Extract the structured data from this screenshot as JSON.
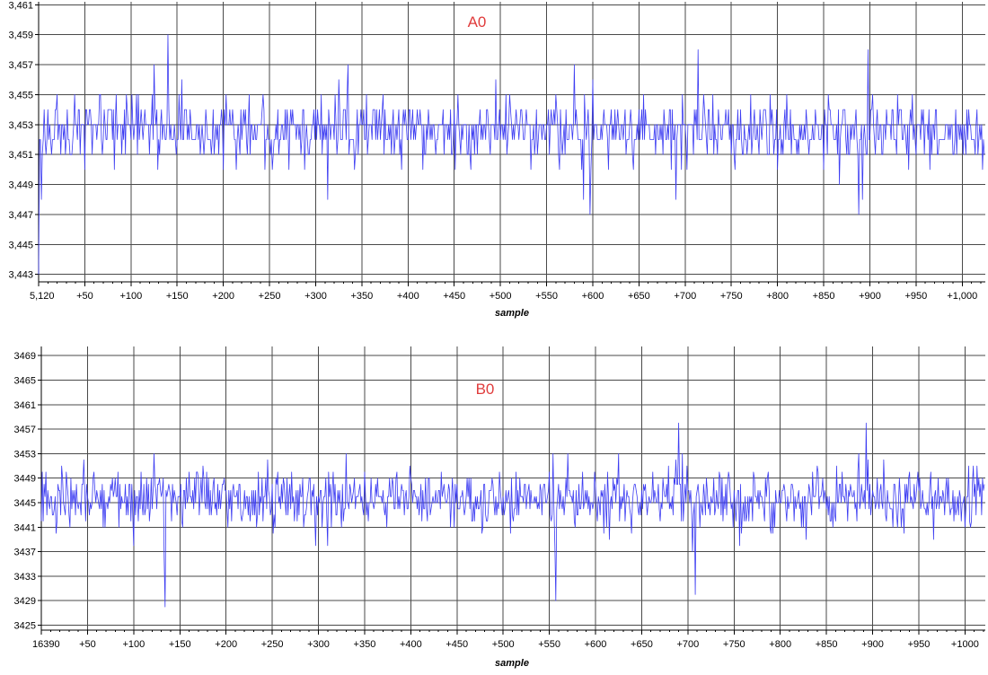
{
  "colors": {
    "series": "#3d3df2",
    "grid": "#4a4a4a",
    "axis": "#000000",
    "label": "#e03c3c",
    "text": "#000000"
  },
  "chart_data": [
    {
      "type": "line",
      "title": "A0",
      "xlabel": "sample",
      "ylabel": "",
      "grid": true,
      "legend": "none",
      "xlim": [
        0,
        1025
      ],
      "ylim": [
        3442.5,
        3461.2
      ],
      "x_ticks": [
        0,
        50,
        100,
        150,
        200,
        250,
        300,
        350,
        400,
        450,
        500,
        550,
        600,
        650,
        700,
        750,
        800,
        850,
        900,
        950,
        1000
      ],
      "x_tick_labels": [
        "5,120",
        "+50",
        "+100",
        "+150",
        "+200",
        "+250",
        "+300",
        "+350",
        "+400",
        "+450",
        "+500",
        "+550",
        "+600",
        "+650",
        "+700",
        "+750",
        "+800",
        "+850",
        "+900",
        "+950",
        "+1,000"
      ],
      "y_ticks": [
        3443,
        3445,
        3447,
        3449,
        3451,
        3453,
        3455,
        3457,
        3459,
        3461
      ],
      "y_tick_labels": [
        "3,443",
        "3,445",
        "3,447",
        "3,449",
        "3,451",
        "3,453",
        "3,455",
        "3,457",
        "3,459",
        "3,461"
      ],
      "series": [
        {
          "baseline": 3452.6,
          "noise": 1.0,
          "quantum": 1,
          "seed": 17,
          "spikes": [
            [
              0,
              3443
            ],
            [
              3,
              3448
            ],
            [
              20,
              3455
            ],
            [
              50,
              3450
            ],
            [
              125,
              3457
            ],
            [
              140,
              3459
            ],
            [
              155,
              3456
            ],
            [
              200,
              3450
            ],
            [
              214,
              3450
            ],
            [
              313,
              3448
            ],
            [
              325,
              3456
            ],
            [
              335,
              3457
            ],
            [
              355,
              3455
            ],
            [
              495,
              3456
            ],
            [
              510,
              3455
            ],
            [
              560,
              3455
            ],
            [
              580,
              3457
            ],
            [
              590,
              3448
            ],
            [
              597,
              3447
            ],
            [
              600,
              3456
            ],
            [
              685,
              3450
            ],
            [
              690,
              3448
            ],
            [
              714,
              3458
            ],
            [
              720,
              3455
            ],
            [
              800,
              3450
            ],
            [
              855,
              3455
            ],
            [
              867,
              3449
            ],
            [
              888,
              3447
            ],
            [
              892,
              3448
            ],
            [
              898,
              3458
            ],
            [
              930,
              3455
            ],
            [
              1017,
              3451
            ]
          ],
          "n": 1025
        }
      ]
    },
    {
      "type": "line",
      "title": "B0",
      "xlabel": "sample",
      "ylabel": "",
      "grid": true,
      "legend": "none",
      "xlim": [
        0,
        1022
      ],
      "ylim": [
        3424.2,
        3470.5
      ],
      "x_ticks": [
        0,
        50,
        100,
        150,
        200,
        250,
        300,
        350,
        400,
        450,
        500,
        550,
        600,
        650,
        700,
        750,
        800,
        850,
        900,
        950,
        1000
      ],
      "x_tick_labels": [
        "16390",
        "+50",
        "+100",
        "+150",
        "+200",
        "+250",
        "+300",
        "+350",
        "+400",
        "+450",
        "+500",
        "+550",
        "+600",
        "+650",
        "+700",
        "+750",
        "+800",
        "+850",
        "+900",
        "+950",
        "+1000"
      ],
      "y_ticks": [
        3425,
        3429,
        3433,
        3437,
        3441,
        3445,
        3449,
        3453,
        3457,
        3461,
        3465,
        3469
      ],
      "y_tick_labels": [
        "3425",
        "3429",
        "3433",
        "3437",
        "3441",
        "3445",
        "3449",
        "3453",
        "3457",
        "3461",
        "3465",
        "3469"
      ],
      "series": [
        {
          "baseline": 3445.5,
          "noise": 2.4,
          "quantum": 1,
          "seed": 91,
          "spikes": [
            [
              122,
              3453
            ],
            [
              128,
              3449
            ],
            [
              133,
              3436
            ],
            [
              134,
              3428
            ],
            [
              310,
              3438
            ],
            [
              330,
              3453
            ],
            [
              385,
              3450
            ],
            [
              556,
              3438
            ],
            [
              557,
              3429
            ],
            [
              570,
              3453
            ],
            [
              625,
              3453
            ],
            [
              690,
              3458
            ],
            [
              694,
              3453
            ],
            [
              705,
              3437
            ],
            [
              708,
              3430
            ],
            [
              885,
              3453
            ],
            [
              893,
              3458
            ],
            [
              905,
              3449
            ],
            [
              980,
              3449
            ]
          ],
          "n": 1022
        }
      ]
    }
  ]
}
